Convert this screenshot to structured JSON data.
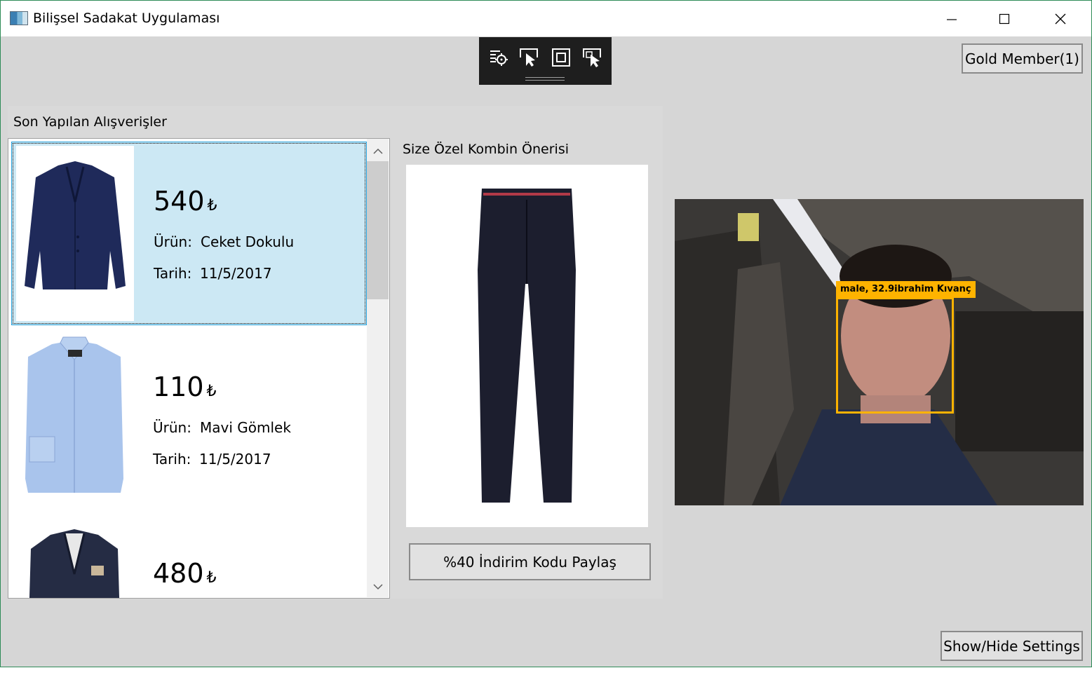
{
  "window": {
    "title": "Bilişsel Sadakat Uygulaması",
    "icon": "app-icon",
    "controls": [
      "minimize-icon",
      "maximize-icon",
      "close-icon"
    ]
  },
  "toolbar": {
    "tools": [
      "select-element-icon",
      "pointer-select-icon",
      "layout-adorner-icon",
      "track-focus-icon"
    ]
  },
  "header": {
    "member_button": "Gold Member(1)"
  },
  "purchases": {
    "title": "Son Yapılan Alışverişler",
    "product_label": "Ürün:",
    "date_label": "Tarih:",
    "currency": "₺",
    "items": [
      {
        "price": "540",
        "product": "Ceket Dokulu",
        "date": "11/5/2017",
        "selected": true
      },
      {
        "price": "110",
        "product": "Mavi Gömlek",
        "date": "11/5/2017",
        "selected": false
      },
      {
        "price": "480",
        "product": "",
        "date": "",
        "selected": false
      }
    ]
  },
  "recommendation": {
    "title": "Size Özel Kombin Önerisi",
    "discount_button": "%40 İndirim Kodu Paylaş"
  },
  "camera": {
    "face_label": "male, 32.9ibrahim Kıvanç"
  },
  "footer": {
    "settings_button": "Show/Hide Settings"
  },
  "colors": {
    "window_bg": "#d6d6d6",
    "selected_item": "#cce8f4",
    "selection_border": "#26a0da",
    "face_box": "#ffb300",
    "toolbar_bg": "#1e1e1e"
  }
}
